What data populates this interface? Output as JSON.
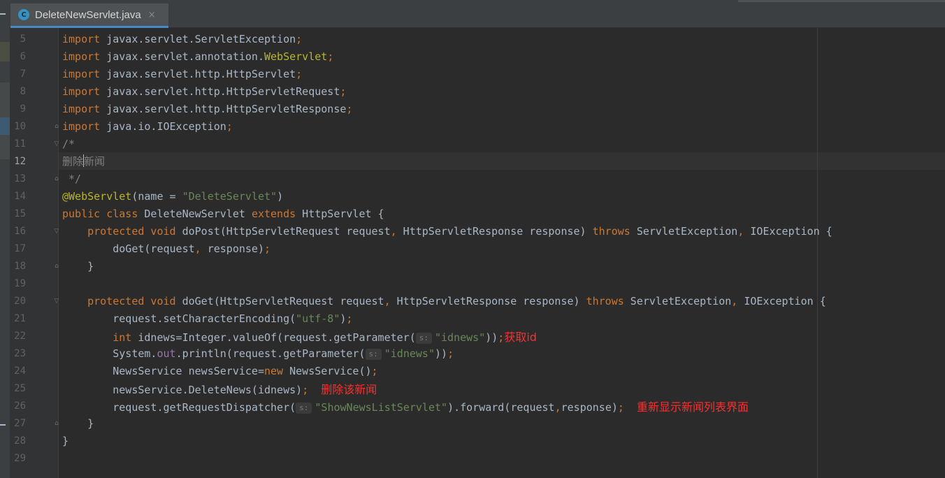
{
  "tab": {
    "icon_letter": "C",
    "title": "DeleteNewServlet.java",
    "close": "×"
  },
  "gutter": {
    "lines": [
      "5",
      "6",
      "7",
      "8",
      "9",
      "10",
      "11",
      "12",
      "13",
      "14",
      "15",
      "16",
      "17",
      "18",
      "19",
      "20",
      "21",
      "22",
      "23",
      "24",
      "25",
      "26",
      "27",
      "28",
      "29"
    ],
    "current_line": "12"
  },
  "code": {
    "l5": {
      "kw": "import",
      "rest": " javax.servlet.ServletException",
      "semi": ";"
    },
    "l6": {
      "kw": "import",
      "pre": " javax.servlet.annotation.",
      "ann": "WebServlet",
      "semi": ";"
    },
    "l7": {
      "kw": "import",
      "rest": " javax.servlet.http.HttpServlet",
      "semi": ";"
    },
    "l8": {
      "kw": "import",
      "rest": " javax.servlet.http.HttpServletRequest",
      "semi": ";"
    },
    "l9": {
      "kw": "import",
      "rest": " javax.servlet.http.HttpServletResponse",
      "semi": ";"
    },
    "l10": {
      "kw": "import",
      "rest": " java.io.IOException",
      "semi": ";"
    },
    "l11": {
      "text": "/*"
    },
    "l12": {
      "a": "删除",
      "b": "新闻"
    },
    "l13": {
      "text": " */"
    },
    "l14": {
      "ann": "@WebServlet",
      "a": "(name = ",
      "str": "\"DeleteServlet\"",
      "b": ")"
    },
    "l15": {
      "kw1": "public class",
      "a": " DeleteNewServlet ",
      "kw2": "extends",
      "b": " HttpServlet {"
    },
    "l16": {
      "kw1": "protected void",
      "a": " doPost(HttpServletRequest request",
      "c1": ",",
      "b": " HttpServletResponse response) ",
      "kw2": "throws",
      "c": " ServletException",
      "c2": ",",
      "d": " IOException {"
    },
    "l17": {
      "a": "doGet(request",
      "c1": ",",
      "b": " response)",
      "semi": ";"
    },
    "l18": {
      "text": "}"
    },
    "l19": {
      "text": ""
    },
    "l20": {
      "kw1": "protected void",
      "a": " doGet(HttpServletRequest request",
      "c1": ",",
      "b": " HttpServletResponse response) ",
      "kw2": "throws",
      "c": " ServletException",
      "c2": ",",
      "d": " IOException {"
    },
    "l21": {
      "a": "request.setCharacterEncoding(",
      "str": "\"utf-8\"",
      "b": ")",
      "semi": ";"
    },
    "l22": {
      "kw": "int",
      "a": " idnews=Integer.valueOf(request.getParameter(",
      "hint": "s:",
      "str": "\"idnews\"",
      "b": "))",
      "semi": ";"
    },
    "l23": {
      "a": "System.",
      "field": "out",
      "b": ".println(request.getParameter(",
      "hint": "s:",
      "str": "\"idnews\"",
      "c": "))",
      "semi": ";"
    },
    "l24": {
      "a": "NewsService newsService=",
      "kw": "new",
      "b": " NewsService()",
      "semi": ";"
    },
    "l25": {
      "a": "newsService.DeleteNews(idnews)",
      "semi": ";"
    },
    "l26": {
      "a": "request.getRequestDispatcher(",
      "hint": "s:",
      "str": "\"ShowNewsListServlet\"",
      "b": ").forward(request",
      "c1": ",",
      "c": "response)",
      "semi": ";"
    },
    "l27": {
      "text": "}"
    },
    "l28": {
      "text": "}"
    },
    "l29": {
      "text": ""
    }
  },
  "annotations": {
    "get_id": "获取id",
    "delete_news": "删除该新闻",
    "redisplay": "重新显示新闻列表界面"
  },
  "colors": {
    "background": "#2b2b2b",
    "keyword": "#cc7832",
    "string": "#6a8759",
    "annotation": "#bbb529",
    "comment": "#808080",
    "note_red": "#ff2d2d"
  }
}
